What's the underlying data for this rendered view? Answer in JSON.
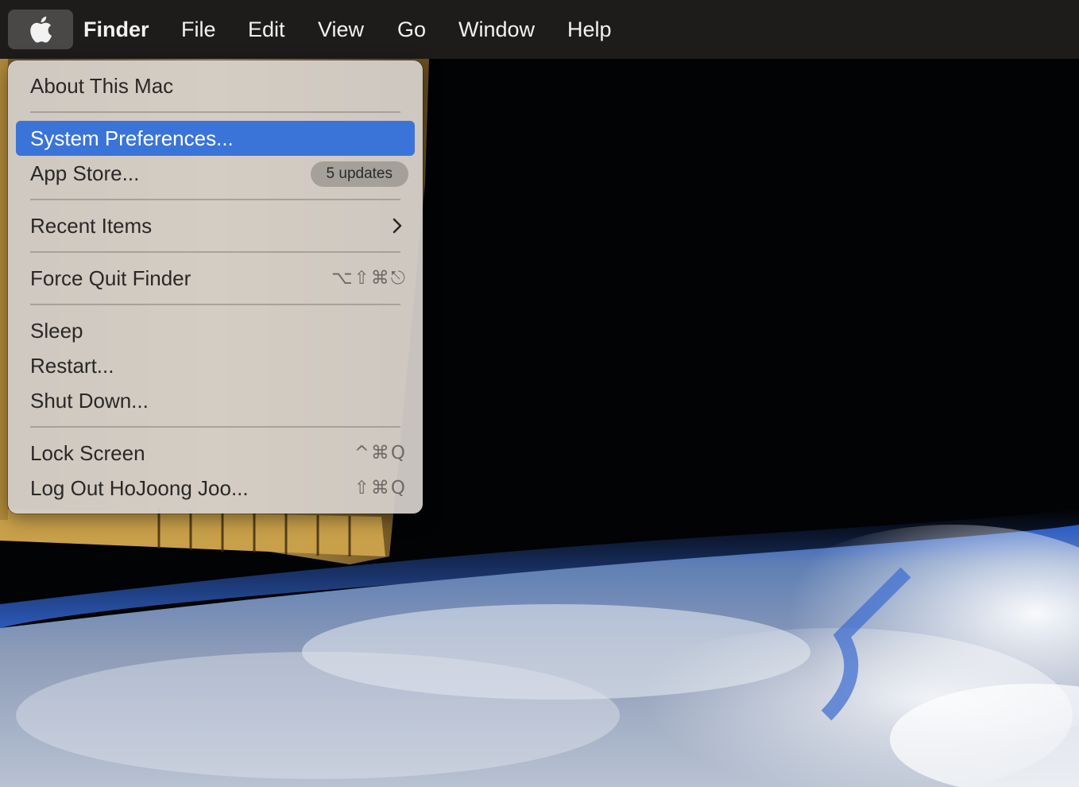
{
  "menubar": {
    "apple_icon": "apple-logo-icon",
    "items": [
      {
        "label": "Finder",
        "bold": true
      },
      {
        "label": "File"
      },
      {
        "label": "Edit"
      },
      {
        "label": "View"
      },
      {
        "label": "Go"
      },
      {
        "label": "Window"
      },
      {
        "label": "Help"
      }
    ]
  },
  "apple_menu": {
    "about": "About This Mac",
    "system_preferences": "System Preferences...",
    "app_store": "App Store...",
    "app_store_badge": "5 updates",
    "recent_items": "Recent Items",
    "force_quit": "Force Quit Finder",
    "force_quit_shortcut": "⌥⇧⌘⎋",
    "sleep": "Sleep",
    "restart": "Restart...",
    "shut_down": "Shut Down...",
    "lock_screen": "Lock Screen",
    "lock_screen_shortcut": "^⌘Q",
    "log_out": "Log Out HoJoong Joo...",
    "log_out_shortcut": "⇧⌘Q"
  },
  "colors": {
    "menubar_bg": "#1e1c1a",
    "menu_bg": "#d6d1cc",
    "highlight": "#3a74d8"
  },
  "wallpaper": {
    "description_icon": "earth-from-space-wallpaper"
  }
}
